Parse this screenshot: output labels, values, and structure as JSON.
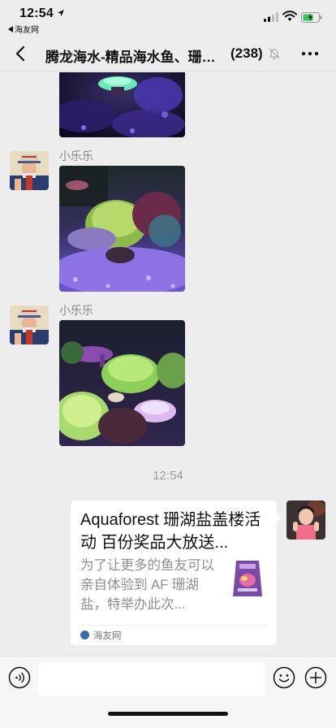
{
  "status_bar": {
    "time": "12:54",
    "back_app": "海友网"
  },
  "nav": {
    "title": "腾龙海水-精品海水鱼、珊…",
    "member_count": "(238)"
  },
  "messages": [
    {
      "type": "image",
      "sender": "",
      "description": "coral-photo-top"
    },
    {
      "type": "image",
      "sender": "小乐乐"
    },
    {
      "type": "image",
      "sender": "小乐乐"
    }
  ],
  "timestamp": "12:54",
  "link_card": {
    "title": "Aquaforest 珊湖盐盖楼活动 百份奖品大放送...",
    "description": "为了让更多的鱼友可以亲自体验到 AF 珊湖盐，特举办此次...",
    "source": "海友网"
  },
  "colors": {
    "background": "#ededed",
    "card": "#ffffff",
    "secondary_text": "#888888"
  },
  "icons": [
    "location-arrow-icon",
    "signal-icon",
    "wifi-icon",
    "battery-icon",
    "back-chevron-icon",
    "mute-bell-icon",
    "more-dots-icon",
    "voice-icon",
    "emoji-icon",
    "plus-icon"
  ]
}
